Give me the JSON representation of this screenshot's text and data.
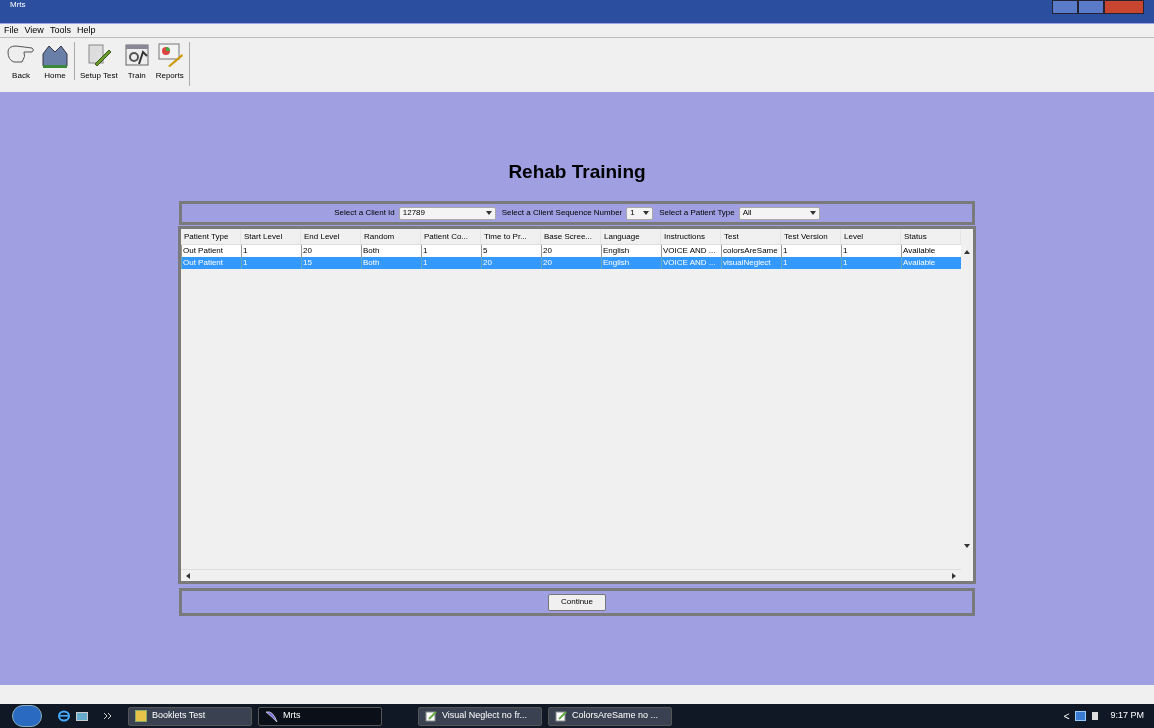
{
  "window": {
    "title": "Mrts"
  },
  "menu": [
    "File",
    "View",
    "Tools",
    "Help"
  ],
  "toolbar": [
    {
      "label": "Back",
      "kind": "back"
    },
    {
      "label": "Home",
      "kind": "home"
    },
    {
      "label": "Setup Test",
      "kind": "setup",
      "separator_before": true
    },
    {
      "label": "Train",
      "kind": "train"
    },
    {
      "label": "Reports",
      "kind": "reports"
    }
  ],
  "heading": "Rehab Training",
  "filters": [
    {
      "label": "Select a Client Id",
      "value": "12789"
    },
    {
      "label": "Select a Client Sequence Number",
      "value": "1"
    },
    {
      "label": "Select a Patient Type",
      "value": "All"
    }
  ],
  "table": {
    "columns": [
      "Patient Type",
      "Start Level",
      "End Level",
      "Random",
      "Patient Co...",
      "Time to Pr...",
      "Base Scree...",
      "Language",
      "Instructions",
      "Test",
      "Test Version",
      "Level",
      "Status"
    ],
    "rows": [
      {
        "selected": false,
        "cells": [
          "Out Patient",
          "1",
          "20",
          "Both",
          "1",
          "5",
          "20",
          "English",
          "VOICE AND ...",
          "colorsAreSame",
          "1",
          "1",
          "Available"
        ]
      },
      {
        "selected": true,
        "cells": [
          "Out Patient",
          "1",
          "15",
          "Both",
          "1",
          "20",
          "20",
          "English",
          "VOICE AND ...",
          "visualNeglect",
          "1",
          "1",
          "Available"
        ]
      }
    ]
  },
  "continue_button": "Continue",
  "taskbar": {
    "items": [
      {
        "label": "Booklets Test",
        "selected": false,
        "kind": "folder"
      },
      {
        "label": "Mrts",
        "selected": true,
        "kind": "app"
      },
      {
        "label": "Visual Neglect  no fr...",
        "selected": false,
        "kind": "doc"
      },
      {
        "label": "ColorsAreSame  no ...",
        "selected": false,
        "kind": "doc"
      }
    ],
    "clock": "9:17 PM",
    "tray_arrow": "<"
  }
}
